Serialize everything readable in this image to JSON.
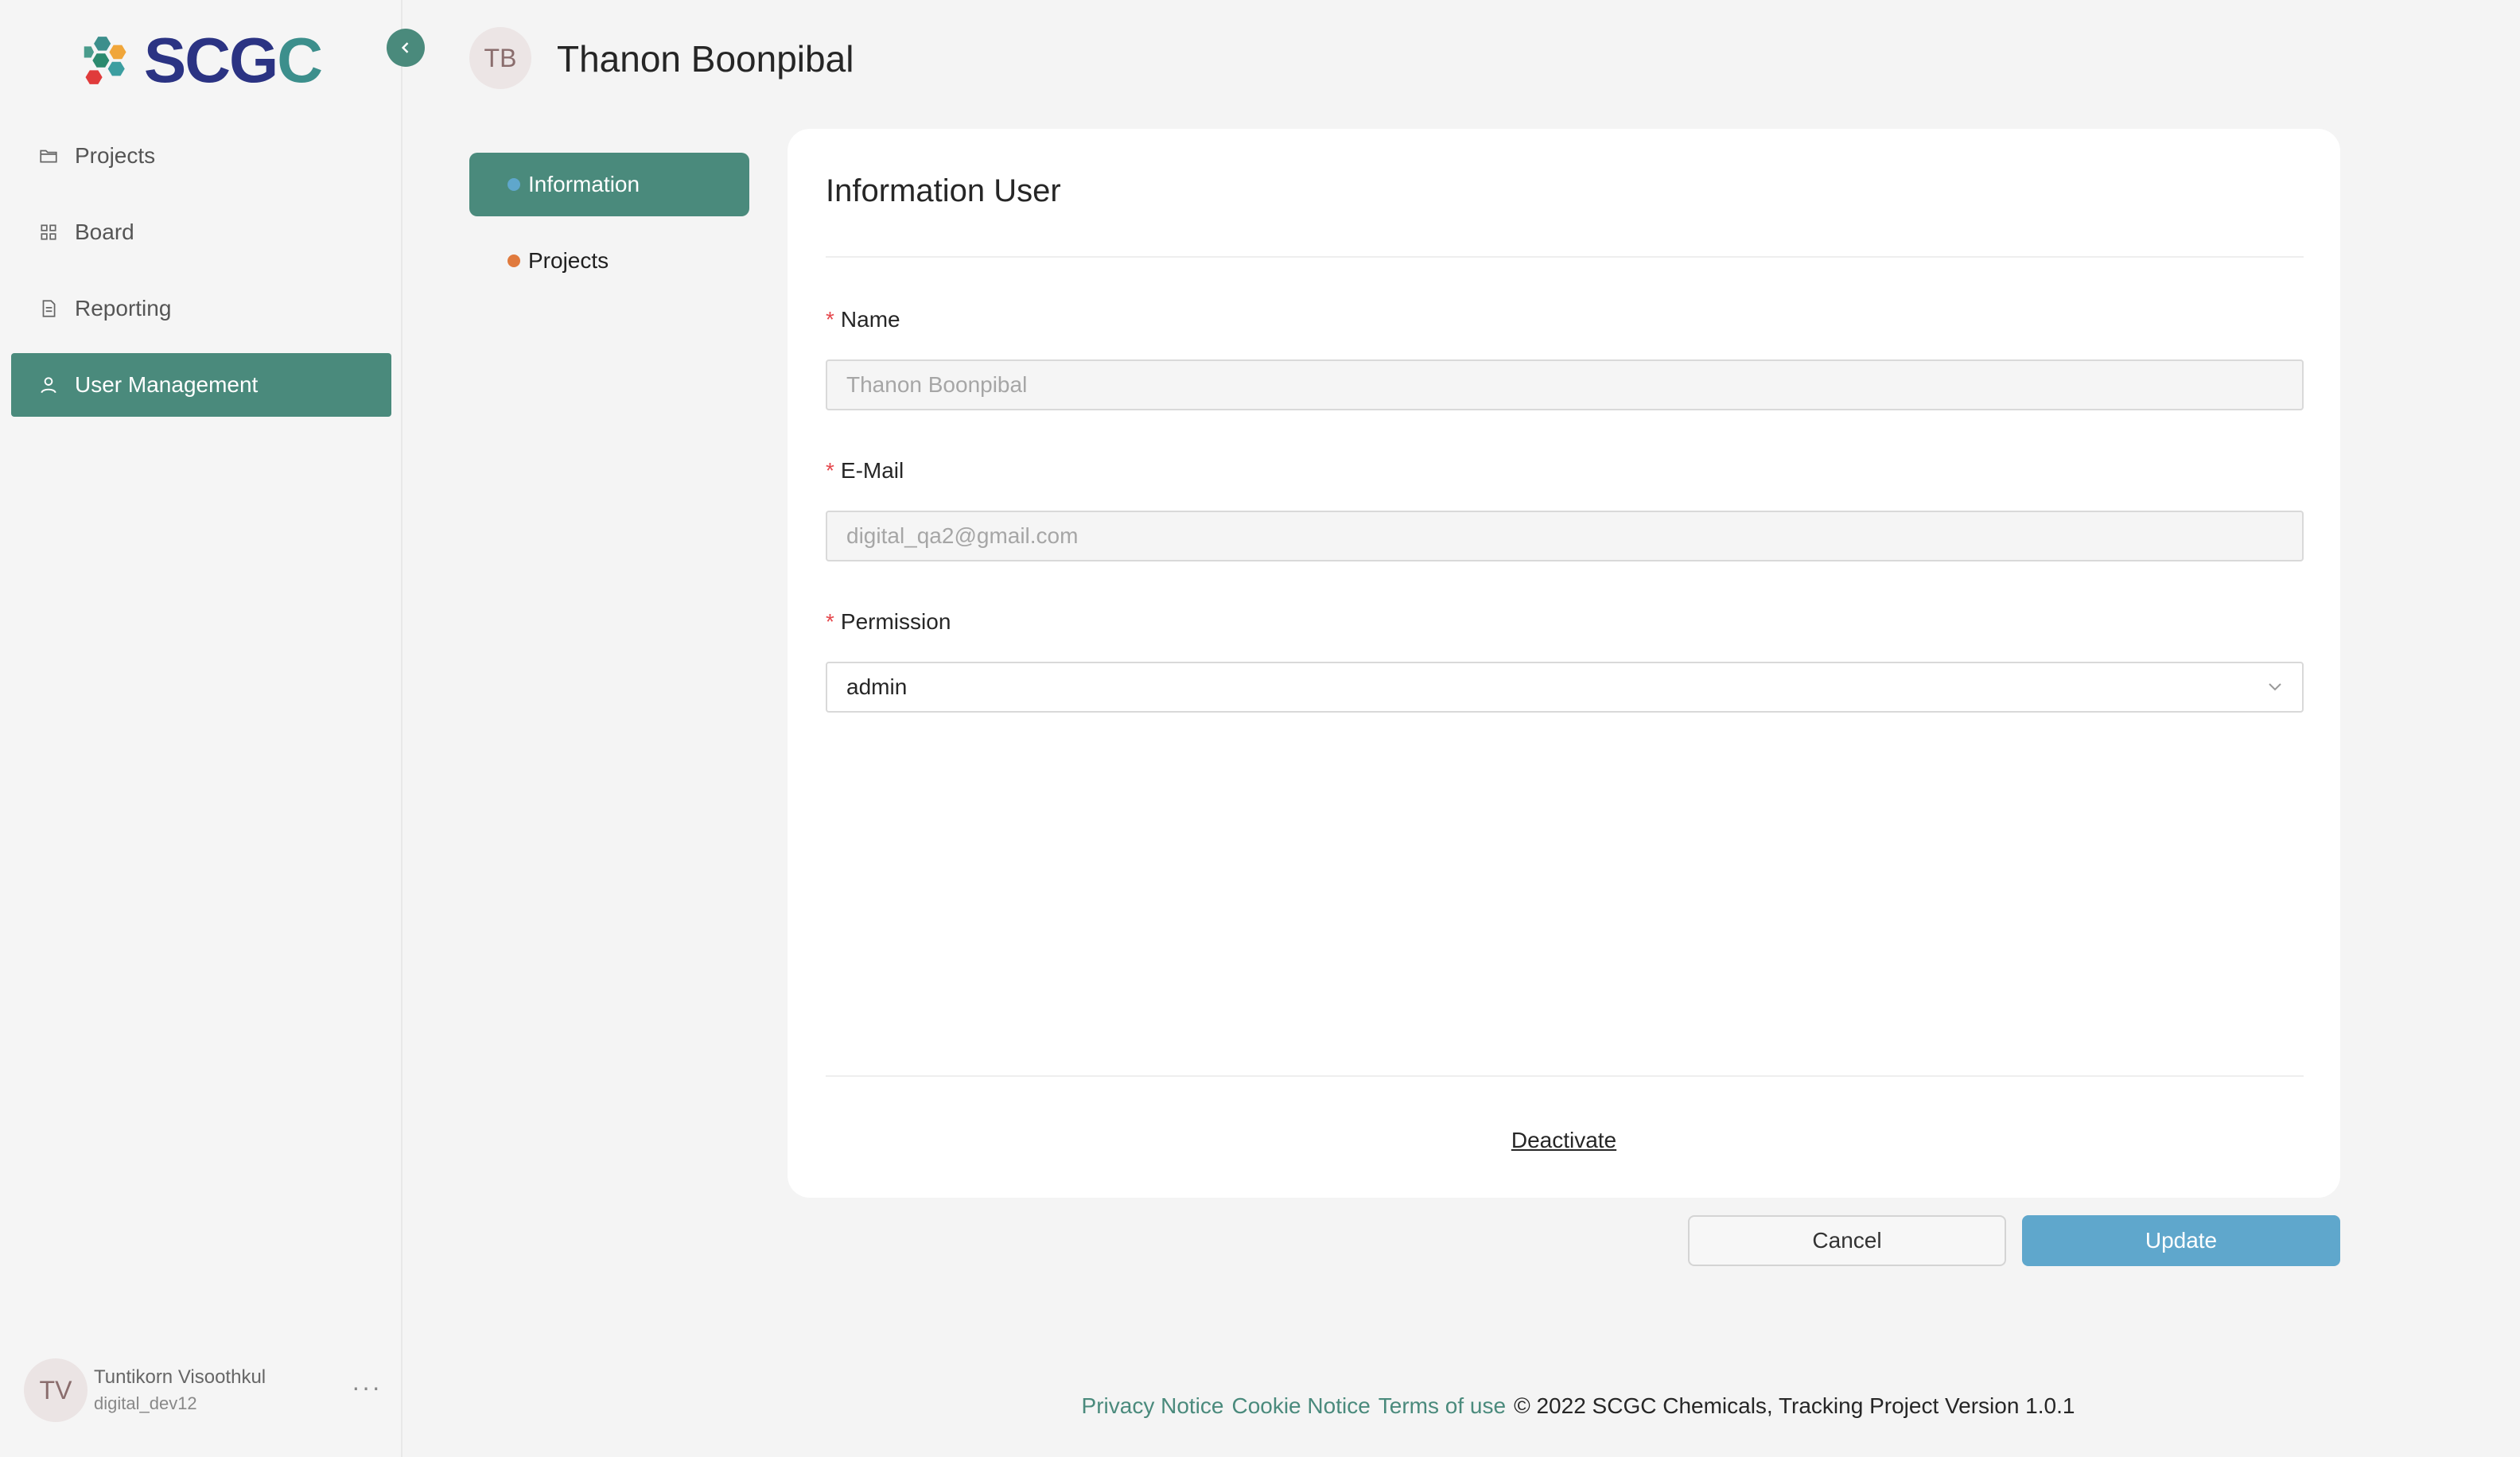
{
  "brand": {
    "logo_text_part1": "SCG",
    "logo_text_part2": "C",
    "colors": {
      "primary": "#4a8a7c",
      "navy": "#2b3383",
      "teal": "#3c8f8c",
      "update": "#5fa7cc"
    }
  },
  "sidebar": {
    "collapse_icon": "chevron-left-icon",
    "items": [
      {
        "label": "Projects",
        "icon": "folder-icon"
      },
      {
        "label": "Board",
        "icon": "grid-icon"
      },
      {
        "label": "Reporting",
        "icon": "document-icon"
      },
      {
        "label": "User Management",
        "icon": "user-icon",
        "active": true
      }
    ],
    "user": {
      "initials": "TV",
      "name": "Tuntikorn Visoothkul",
      "id": "digital_dev12",
      "more": "···"
    }
  },
  "header": {
    "initials": "TB",
    "title": "Thanon Boonpibal"
  },
  "subnav": {
    "items": [
      {
        "label": "Information",
        "active": true,
        "dot_color": "#5fa7cc"
      },
      {
        "label": "Projects",
        "dot_color": "#e07a3d"
      }
    ]
  },
  "form": {
    "title": "Information User",
    "required_mark": "*",
    "name": {
      "label": "Name",
      "value": "Thanon Boonpibal"
    },
    "email": {
      "label": "E-Mail",
      "value": "digital_qa2@gmail.com"
    },
    "permission": {
      "label": "Permission",
      "value": "admin"
    },
    "deactivate": "Deactivate"
  },
  "actions": {
    "cancel": "Cancel",
    "update": "Update"
  },
  "footer": {
    "privacy": "Privacy Notice",
    "cookie": "Cookie Notice",
    "terms": "Terms of use",
    "copyright": "© 2022 SCGC Chemicals, Tracking Project Version 1.0.1"
  }
}
